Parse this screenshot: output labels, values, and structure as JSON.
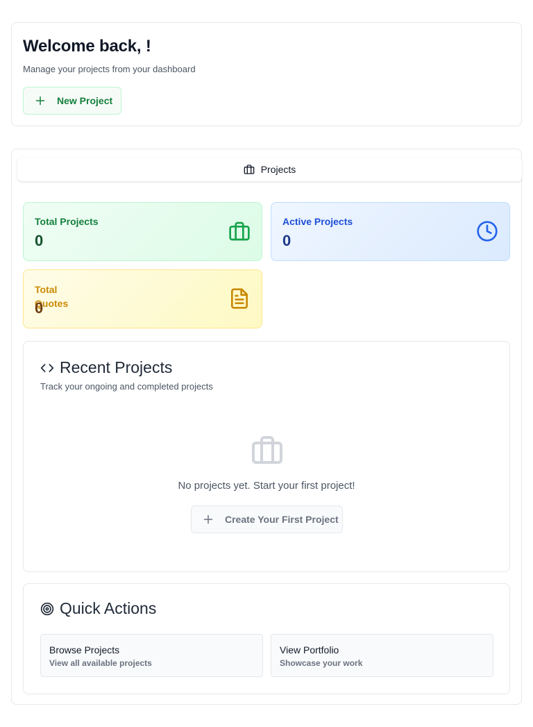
{
  "welcome": {
    "title": "Welcome back, !",
    "subtitle": "Manage your projects from your dashboard",
    "new_project_label": "New Project"
  },
  "tabs": [
    {
      "label": "Projects",
      "icon": "briefcase-icon",
      "active": true
    }
  ],
  "stats": {
    "total_projects": {
      "label": "Total Projects",
      "value": "0",
      "icon": "briefcase-icon",
      "color": "#16a34a"
    },
    "active_projects": {
      "label": "Active Projects",
      "value": "0",
      "icon": "clock-icon",
      "color": "#2563eb"
    },
    "total_quotes": {
      "label": "Total Quotes",
      "value": "0",
      "icon": "document-icon",
      "color": "#ca8a04"
    }
  },
  "recent_projects": {
    "title": "Recent Projects",
    "subtitle": "Track your ongoing and completed projects",
    "empty_text": "No projects yet. Start your first project!",
    "create_label": "Create Your First Project"
  },
  "quick_actions": {
    "title": "Quick Actions",
    "items": [
      {
        "title": "Browse Projects",
        "subtitle": "View all available projects"
      },
      {
        "title": "View Portfolio",
        "subtitle": "Showcase your work"
      }
    ]
  }
}
